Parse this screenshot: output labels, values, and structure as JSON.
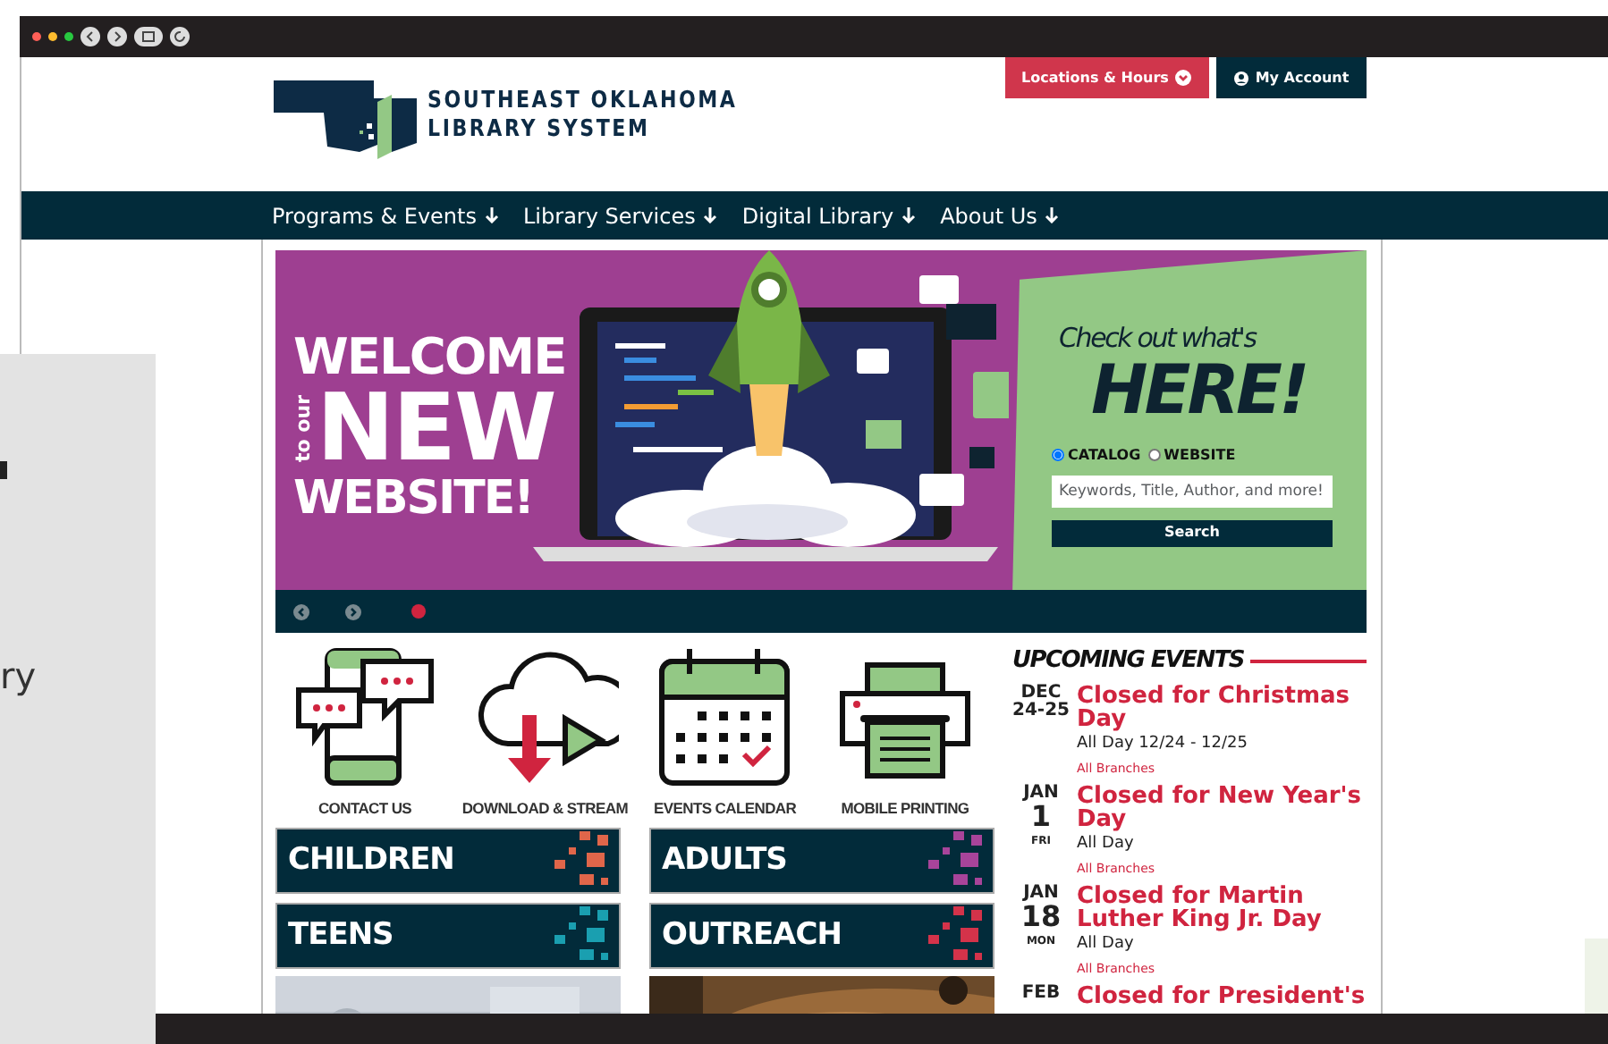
{
  "header": {
    "logo_lines": [
      "SOUTHEAST OKLAHOMA",
      "LIBRARY SYSTEM"
    ],
    "buttons": [
      {
        "label": "Locations & Hours",
        "kind": "dropdown"
      },
      {
        "label": "My Account",
        "kind": "account"
      }
    ]
  },
  "nav": [
    {
      "label": "Programs & Events"
    },
    {
      "label": "Library Services"
    },
    {
      "label": "Digital Library"
    },
    {
      "label": "About Us"
    }
  ],
  "hero": {
    "welcome": "WELCOME",
    "side": "to our",
    "big": "NEW",
    "last": "WEBSITE!",
    "slides": [
      {
        "selected": true
      }
    ]
  },
  "search": {
    "tagline": "Check out what's",
    "headline": "HERE!",
    "scopes": [
      {
        "label": "CATALOG",
        "selected": true
      },
      {
        "label": "WEBSITE",
        "selected": false
      }
    ],
    "placeholder": "Keywords, Title, Author, and more!",
    "button": "Search"
  },
  "quick_links": [
    {
      "label": "CONTACT US",
      "kind": "phone"
    },
    {
      "label": "DOWNLOAD & STREAM",
      "kind": "cloud"
    },
    {
      "label": "EVENTS CALENDAR",
      "kind": "calendar"
    },
    {
      "label": "MOBILE PRINTING",
      "kind": "printer"
    }
  ],
  "categories": [
    {
      "label": "CHILDREN",
      "color": "#e0664a"
    },
    {
      "label": "ADULTS",
      "color": "#a8449a"
    },
    {
      "label": "TEENS",
      "color": "#1a9fb0"
    },
    {
      "label": "OUTREACH",
      "color": "#d4334a"
    }
  ],
  "events_heading": "UPCOMING EVENTS",
  "events": [
    {
      "month": "DEC",
      "day": "24-25",
      "title": "Closed for Christmas Day",
      "time": "All Day 12/24 - 12/25",
      "location": "All Branches"
    },
    {
      "month": "JAN",
      "day": "1",
      "weekday": "FRI",
      "title": "Closed for New Year's Day",
      "time": "All Day",
      "location": "All Branches"
    },
    {
      "month": "JAN",
      "day": "18",
      "weekday": "MON",
      "title": "Closed for Martin Luther King Jr. Day",
      "time": "All Day",
      "location": "All Branches"
    },
    {
      "month": "FEB",
      "title": "Closed for President's"
    }
  ],
  "overlay_panel": {
    "text": "ry"
  }
}
